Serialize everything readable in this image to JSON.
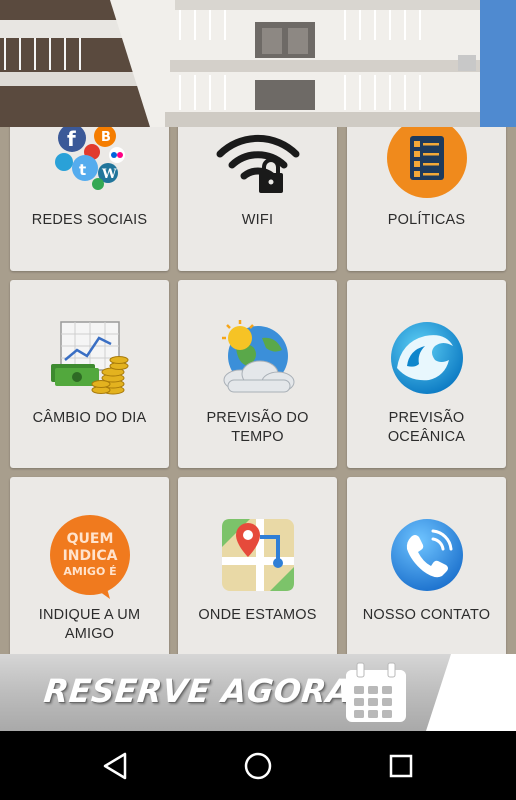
{
  "tiles": [
    {
      "label": "REDES SOCIAIS",
      "icon": "social-networks-icon"
    },
    {
      "label": "WIFI",
      "icon": "wifi-lock-icon"
    },
    {
      "label": "POLÍTICAS",
      "icon": "checklist-icon"
    },
    {
      "label": "CÂMBIO DO DIA",
      "icon": "exchange-chart-money-icon"
    },
    {
      "label": "PREVISÃO DO TEMPO",
      "icon": "weather-icon"
    },
    {
      "label": "PREVISÃO OCEÂNICA",
      "icon": "ocean-wave-icon"
    },
    {
      "label": "INDIQUE A UM AMIGO",
      "icon": "referral-badge-icon",
      "badge_text": [
        "QUEM",
        "INDICA",
        "AMIGO É"
      ]
    },
    {
      "label": "ONDE ESTAMOS",
      "icon": "map-pin-icon"
    },
    {
      "label": "NOSSO CONTATO",
      "icon": "phone-call-icon"
    }
  ],
  "banner": {
    "text": "RESERVE AGORA!",
    "icon": "calendar-icon"
  },
  "navbar": {
    "back": "back-icon",
    "home": "home-icon",
    "recents": "recents-icon"
  },
  "colors": {
    "grid_bg": "#a89e8d",
    "tile_bg": "#ebe9e6",
    "orange": "#f07a1e",
    "blue": "#1e88d8"
  }
}
